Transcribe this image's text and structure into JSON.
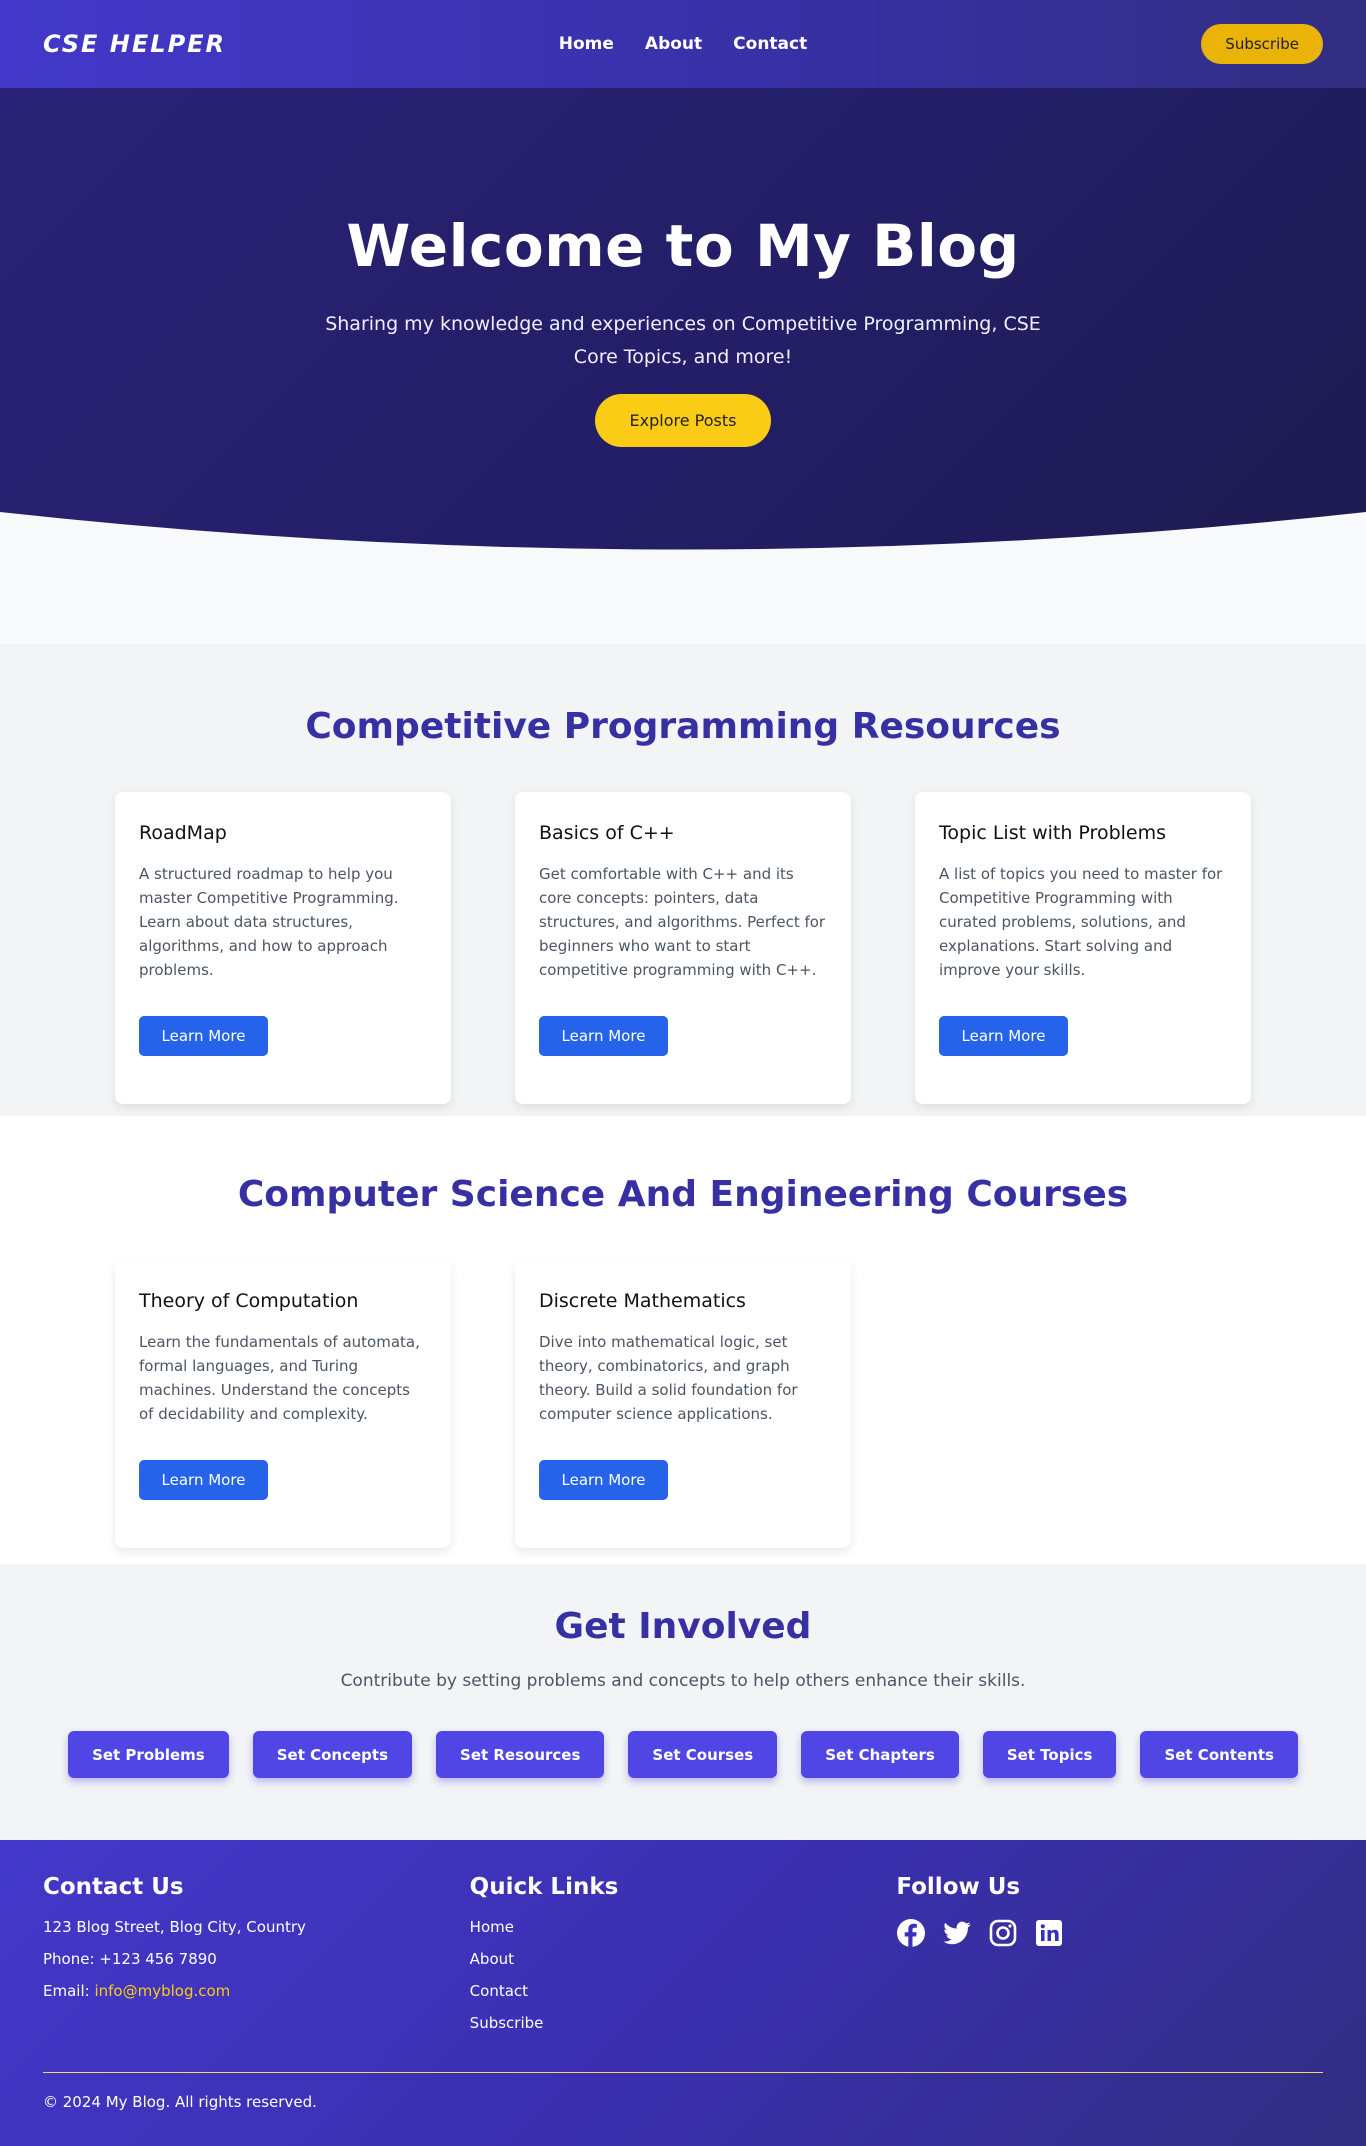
{
  "nav": {
    "brand": "CSE HELPER",
    "links": [
      "Home",
      "About",
      "Contact"
    ],
    "subscribe_label": "Subscribe"
  },
  "hero": {
    "title": "Welcome to My Blog",
    "subtitle": "Sharing my knowledge and experiences on Competitive Programming, CSE Core Topics, and more!",
    "cta_label": "Explore Posts"
  },
  "cp_section": {
    "title": "Competitive Programming Resources",
    "cards": [
      {
        "title": "RoadMap",
        "text": "A structured roadmap to help you master Competitive Programming. Learn about data structures, algorithms, and how to approach problems.",
        "button": "Learn More"
      },
      {
        "title": "Basics of C++",
        "text": "Get comfortable with C++ and its core concepts: pointers, data structures, and algorithms. Perfect for beginners who want to start competitive programming with C++.",
        "button": "Learn More"
      },
      {
        "title": "Topic List with Problems",
        "text": "A list of topics you need to master for Competitive Programming with curated problems, solutions, and explanations. Start solving and improve your skills.",
        "button": "Learn More"
      }
    ]
  },
  "cse_section": {
    "title": "Computer Science And Engineering Courses",
    "cards": [
      {
        "title": "Theory of Computation",
        "text": "Learn the fundamentals of automata, formal languages, and Turing machines. Understand the concepts of decidability and complexity.",
        "button": "Learn More"
      },
      {
        "title": "Discrete Mathematics",
        "text": "Dive into mathematical logic, set theory, combinatorics, and graph theory. Build a solid foundation for computer science applications.",
        "button": "Learn More"
      }
    ]
  },
  "involved": {
    "title": "Get Involved",
    "text": "Contribute by setting problems and concepts to help others enhance their skills.",
    "buttons": [
      "Set Problems",
      "Set Concepts",
      "Set Resources",
      "Set Courses",
      "Set Chapters",
      "Set Topics",
      "Set Contents"
    ]
  },
  "footer": {
    "contact_title": "Contact Us",
    "address": "123 Blog Street, Blog City, Country",
    "phone": "Phone: +123 456 7890",
    "email_label": "Email: ",
    "email": "info@myblog.com",
    "links_title": "Quick Links",
    "links": [
      "Home",
      "About",
      "Contact",
      "Subscribe"
    ],
    "follow_title": "Follow Us",
    "socials": [
      "facebook-icon",
      "twitter-icon",
      "instagram-icon",
      "linkedin-icon"
    ],
    "copyright": "© 2024 My Blog. All rights reserved."
  },
  "colors": {
    "primary": "#3730a3",
    "accent": "#facc15",
    "button_blue": "#2563eb",
    "button_indigo": "#4f46e5"
  }
}
